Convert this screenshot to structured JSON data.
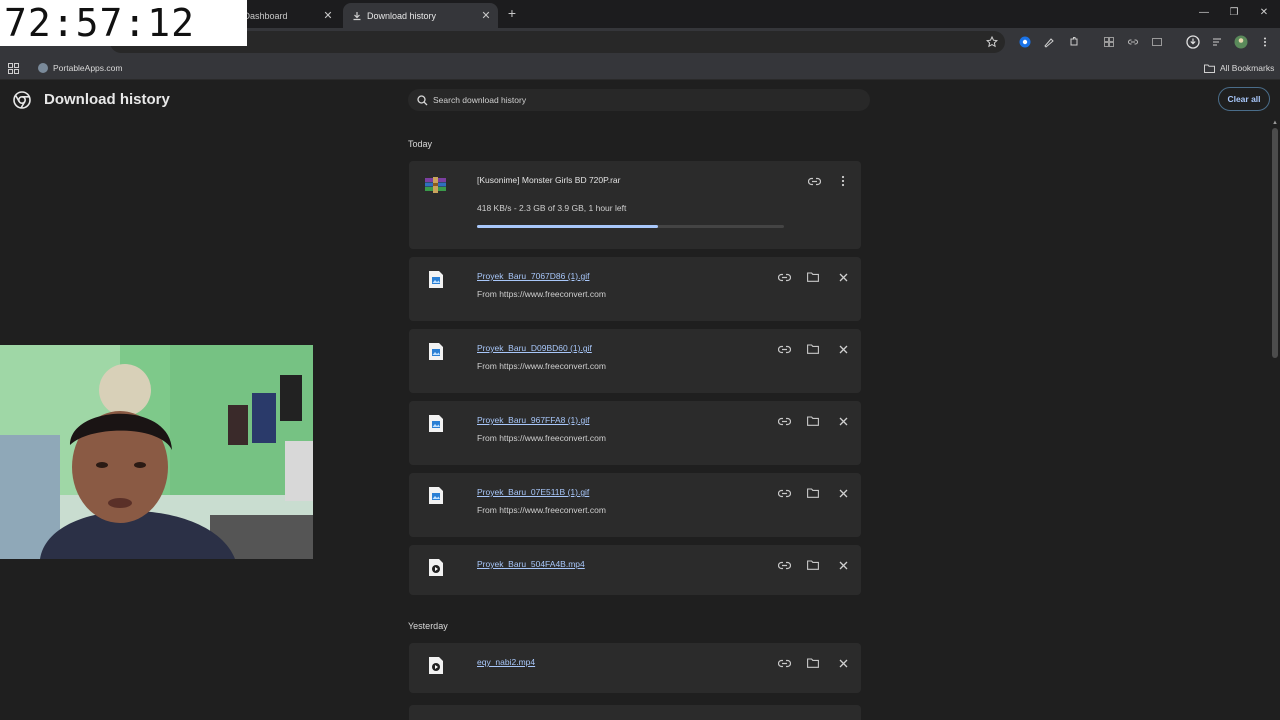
{
  "clock": {
    "time": "72:57:12"
  },
  "tabs": [
    {
      "label": "ck Dashboard",
      "active": false
    },
    {
      "label": "Download history",
      "active": true
    }
  ],
  "bookmarks": {
    "portableapps": "PortableApps.com",
    "all": "All Bookmarks"
  },
  "page": {
    "title": "Download history",
    "search_placeholder": "Search download history",
    "clear_label": "Clear all"
  },
  "sections": {
    "today": "Today",
    "yesterday": "Yesterday"
  },
  "downloads": [
    {
      "name": "[Kusonime] Monster Girls BD 720P.rar",
      "status": "418 KB/s - 2.3 GB of 3.9 GB, 1 hour left",
      "progress": 0.59,
      "icon": "rar-archive-icon"
    },
    {
      "name": "Proyek_Baru_7067D86 (1).gif",
      "source": "From https://www.freeconvert.com",
      "icon": "image-file-icon"
    },
    {
      "name": "Proyek_Baru_D09BD60 (1).gif",
      "source": "From https://www.freeconvert.com",
      "icon": "image-file-icon"
    },
    {
      "name": "Proyek_Baru_967FFA8 (1).gif",
      "source": "From https://www.freeconvert.com",
      "icon": "image-file-icon"
    },
    {
      "name": "Proyek_Baru_07E511B (1).gif",
      "source": "From https://www.freeconvert.com",
      "icon": "image-file-icon"
    },
    {
      "name": "Proyek_Baru_504FA4B.mp4",
      "icon": "video-file-icon"
    },
    {
      "name": "eqy_nabi2.mp4",
      "icon": "video-file-icon"
    }
  ],
  "colors": {
    "accent": "#a8c7fa",
    "background": "#1f1f1f",
    "card": "#2b2b2b"
  }
}
